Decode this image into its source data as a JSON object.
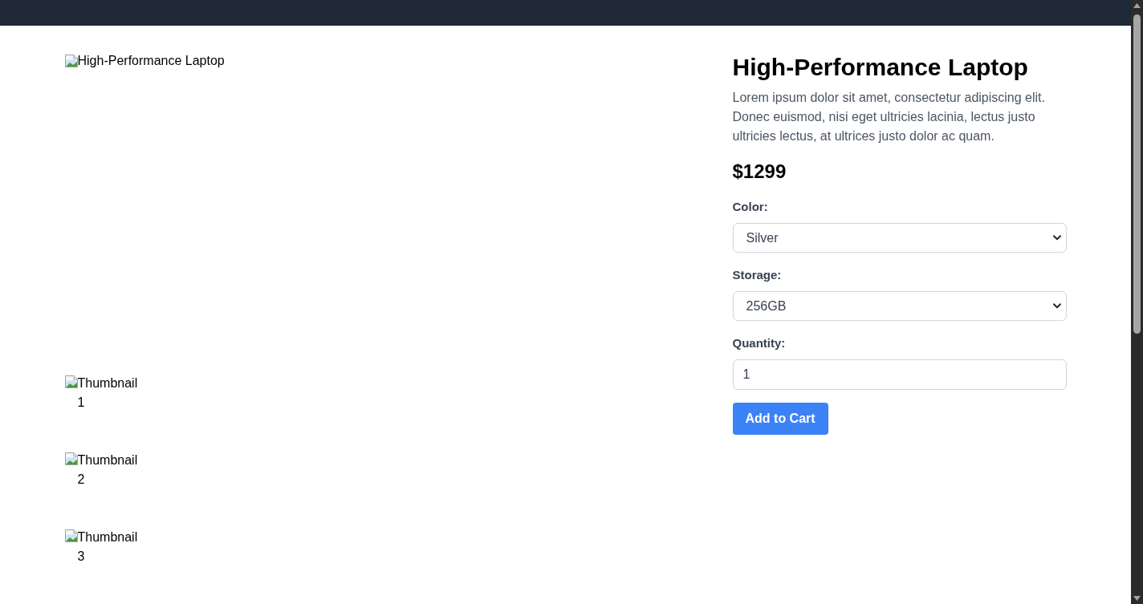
{
  "gallery": {
    "main_image": {
      "alt": "High-Performance Laptop"
    },
    "thumbnails": [
      {
        "alt": "Thumbnail 1"
      },
      {
        "alt": "Thumbnail 2"
      },
      {
        "alt": "Thumbnail 3"
      }
    ]
  },
  "product": {
    "title": "High-Performance Laptop",
    "description": "Lorem ipsum dolor sit amet, consectetur adipiscing elit. Donec euismod, nisi eget ultricies lacinia, lectus justo ultricies lectus, at ultrices justo dolor ac quam.",
    "price": "$1299",
    "options": [
      {
        "kind": "select",
        "label": "Color:",
        "value": "Silver"
      },
      {
        "kind": "select",
        "label": "Storage:",
        "value": "256GB"
      },
      {
        "kind": "input",
        "label": "Quantity:",
        "value": "1"
      }
    ],
    "add_to_cart": "Add to Cart"
  }
}
